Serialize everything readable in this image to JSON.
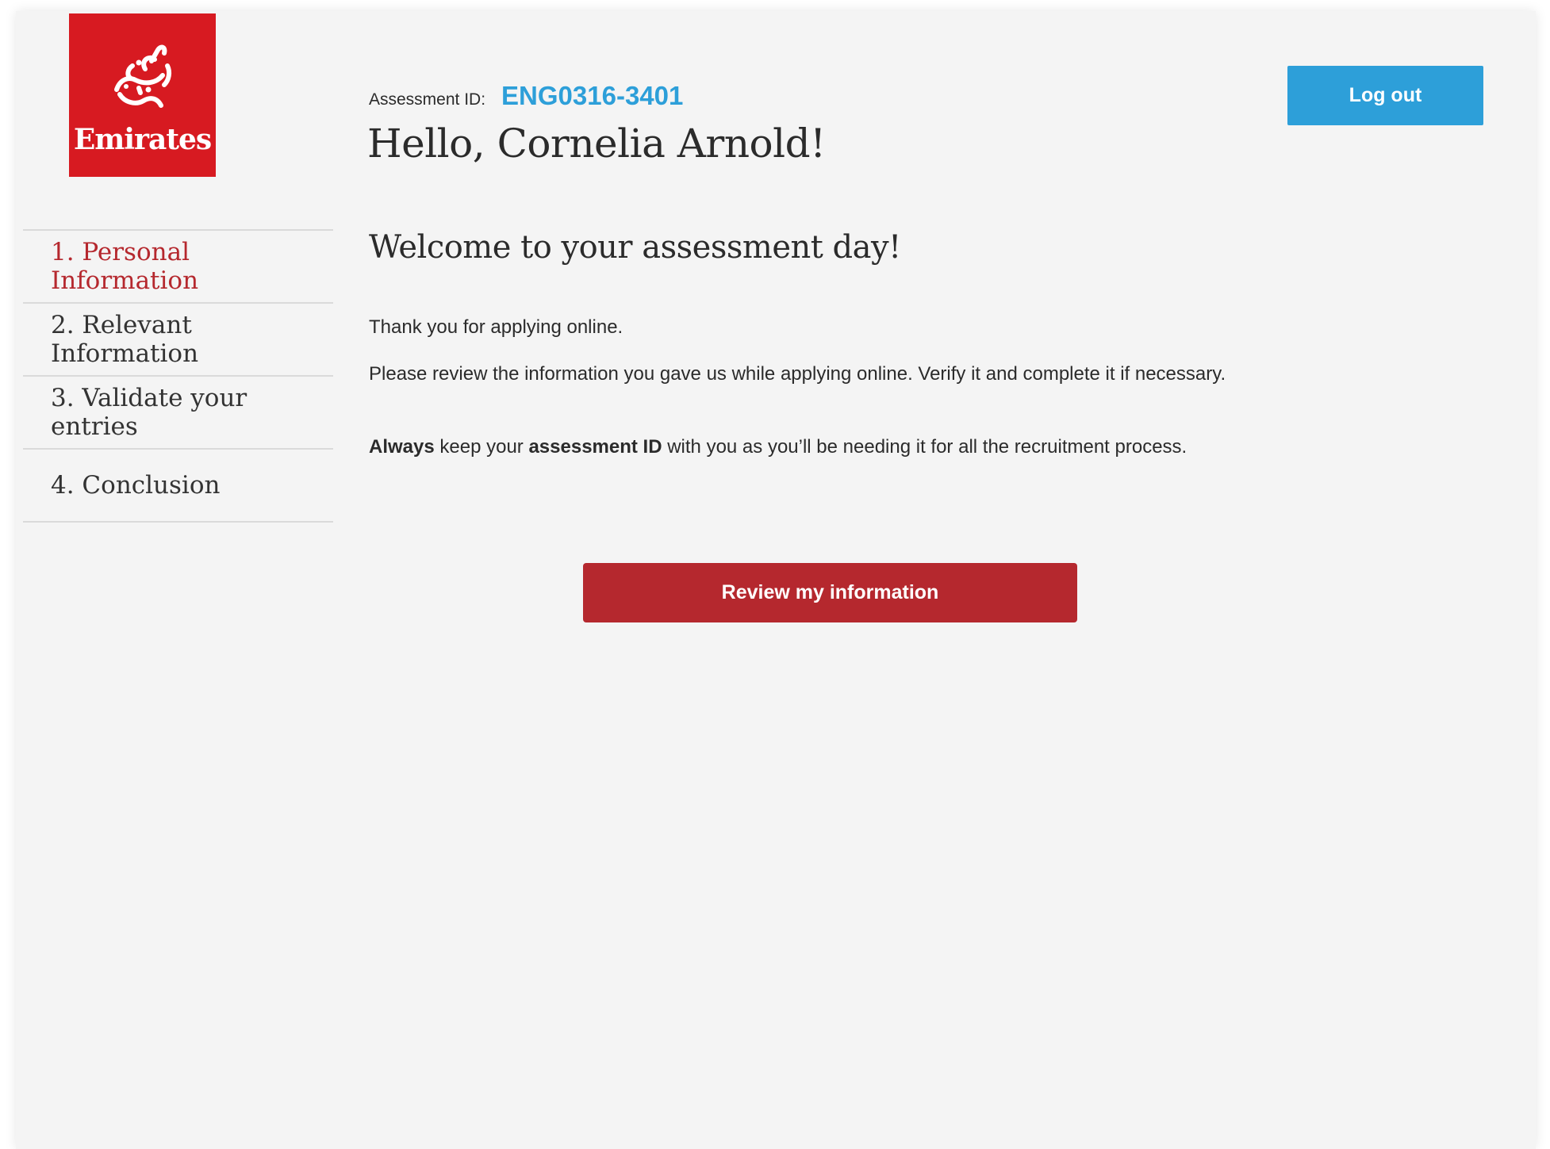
{
  "brand": {
    "logo_text": "Emirates",
    "logo_color": "#d71a21"
  },
  "header": {
    "assessment_label": "Assessment ID:",
    "assessment_id": "ENG0316-3401",
    "greeting": "Hello, Cornelia Arnold!",
    "logout_label": "Log out"
  },
  "sidebar": {
    "items": [
      {
        "label": "1. Personal Information",
        "active": true
      },
      {
        "label": "2. Relevant Information",
        "active": false
      },
      {
        "label": "3. Validate your entries",
        "active": false
      },
      {
        "label": "4. Conclusion",
        "active": false
      }
    ]
  },
  "main": {
    "welcome_title": "Welcome to your assessment day!",
    "thank_you": "Thank you for applying online.",
    "review_text": "Please review the information you gave us while applying online. Verify it and complete it if necessary.",
    "reminder": {
      "always": "Always",
      "part1": " keep your ",
      "assessment_id": "assessment ID",
      "part2": " with you as you’ll be needing it for all the recruitment process."
    },
    "review_button_label": "Review my information"
  },
  "colors": {
    "accent_blue": "#2d9fd9",
    "accent_red": "#b5282e",
    "background": "#f4f4f4"
  }
}
